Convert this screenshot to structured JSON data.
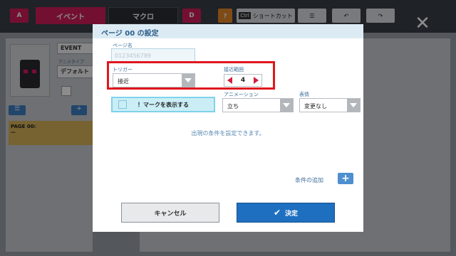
{
  "app": {
    "tabs": {
      "prev_label": "A",
      "event_label": "イベント",
      "macro_label": "マクロ",
      "next_label": "D"
    },
    "toolbar": {
      "help_label": "?",
      "ctrl_label": "Ctrl",
      "shortcut_label": "ショートカット",
      "close_label": "✕"
    }
  },
  "background": {
    "event_name": "EVENT",
    "anime_type_label": "アニメタイプ",
    "anime_type_value": "デフォルト",
    "page_item": {
      "title": "PAGE 00:",
      "subtitle": "—"
    }
  },
  "dialog": {
    "title": "ページ 00 の設定",
    "page_name_label": "ページ名",
    "page_name_placeholder": "0123456789",
    "trigger_label": "トリガー",
    "trigger_value": "接近",
    "range_label": "接近範囲",
    "range_value": "4",
    "mark_button_label": "！マークを表示する",
    "animation_label": "アニメーション",
    "animation_value": "立ち",
    "expression_label": "表情",
    "expression_value": "変更なし",
    "condition_hint": "出現の条件を設定できます。",
    "add_condition_label": "条件の追加",
    "cancel_label": "キャンセル",
    "ok_label": "決定"
  },
  "colors": {
    "accent": "#d21e5a",
    "primary": "#1f6fc0",
    "highlight": "#e0161e"
  }
}
